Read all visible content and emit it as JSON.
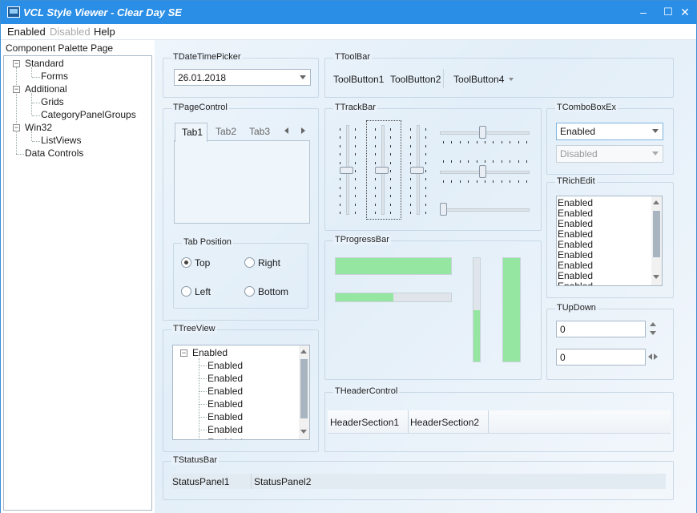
{
  "window": {
    "title": "VCL Style Viewer - Clear Day SE",
    "minimize": "–",
    "maximize": "☐",
    "close": "✕"
  },
  "menu": {
    "items": [
      "Enabled",
      "Disabled",
      "Help"
    ]
  },
  "sidebar": {
    "caption": "Component Palette Page",
    "tree": [
      {
        "label": "Standard",
        "expander": "−"
      },
      {
        "label": "Forms"
      },
      {
        "label": "Additional",
        "expander": "−"
      },
      {
        "label": "Grids"
      },
      {
        "label": "CategoryPanelGroups"
      },
      {
        "label": "Win32",
        "expander": "−"
      },
      {
        "label": "ListViews"
      },
      {
        "label": "Data Controls"
      }
    ]
  },
  "datetimepicker": {
    "caption": "TDateTimePicker",
    "value": "26.01.2018"
  },
  "toolbar": {
    "caption": "TToolBar",
    "buttons": [
      "ToolButton1",
      "ToolButton2",
      "ToolButton4"
    ]
  },
  "pagecontrol": {
    "caption": "TPageControl",
    "tabs": [
      "Tab1",
      "Tab2",
      "Tab3"
    ],
    "active_tab": "Tab1",
    "tab_position": {
      "caption": "Tab Position",
      "options": [
        "Top",
        "Right",
        "Left",
        "Bottom"
      ],
      "selected": "Top"
    }
  },
  "trackbar": {
    "caption": "TTrackBar",
    "levels": {
      "vertical": [
        0.5,
        0.5,
        0.5
      ],
      "horizontal": [
        0.5,
        0.5,
        0.0
      ]
    }
  },
  "comboboxex": {
    "caption": "TComboBoxEx",
    "enabled_value": "Enabled",
    "disabled_value": "Disabled"
  },
  "richedit": {
    "caption": "TRichEdit",
    "lines": [
      "Enabled",
      "Enabled",
      "Enabled",
      "Enabled",
      "Enabled",
      "Enabled",
      "Enabled",
      "Enabled",
      "Enabled"
    ]
  },
  "progressbar": {
    "caption": "TProgressBar",
    "levels": [
      1.0,
      0.5,
      0.5,
      1.0
    ]
  },
  "updown": {
    "caption": "TUpDown",
    "value1": "0",
    "value2": "0"
  },
  "treeview": {
    "caption": "TTreeView",
    "root": "Enabled",
    "expander": "−",
    "children": [
      "Enabled",
      "Enabled",
      "Enabled",
      "Enabled",
      "Enabled",
      "Enabled",
      "Enabled"
    ]
  },
  "headercontrol": {
    "caption": "THeaderControl",
    "sections": [
      "HeaderSection1",
      "HeaderSection2"
    ]
  },
  "statusbar": {
    "caption": "TStatusBar",
    "panels": [
      "StatusPanel1",
      "StatusPanel2"
    ]
  },
  "colors": {
    "titlebar": "#2a8ee6",
    "progress": "#95e6a1",
    "accent": "#3a8fd6"
  }
}
